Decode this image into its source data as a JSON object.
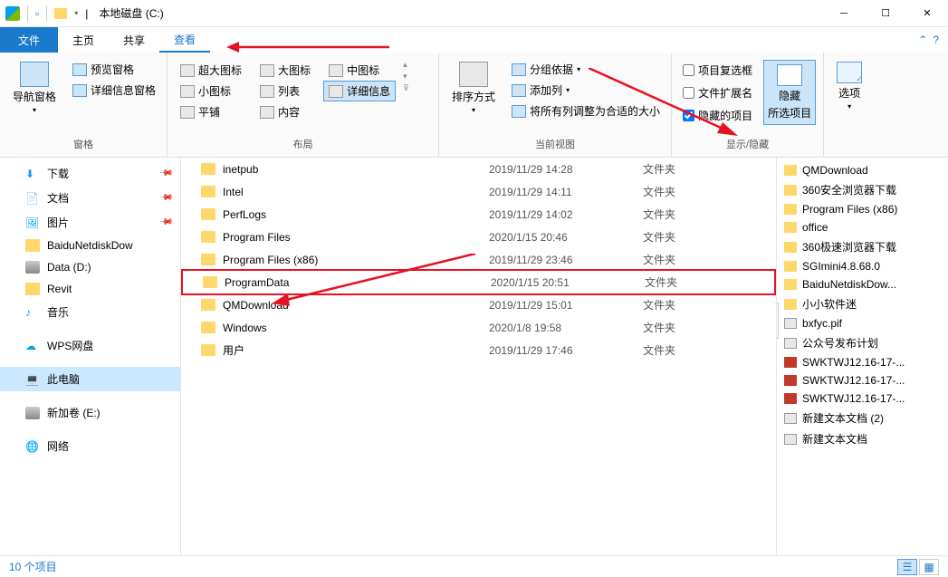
{
  "titlebar": {
    "title": "本地磁盘 (C:)",
    "divider": "|"
  },
  "menu": {
    "file": "文件",
    "home": "主页",
    "share": "共享",
    "view": "查看"
  },
  "ribbon": {
    "panes": {
      "nav_pane": "导航窗格",
      "preview_pane": "预览窗格",
      "details_pane": "详细信息窗格",
      "label": "窗格"
    },
    "layout": {
      "extra_large": "超大图标",
      "large": "大图标",
      "medium": "中图标",
      "small": "小图标",
      "list": "列表",
      "details": "详细信息",
      "tiles": "平铺",
      "content": "内容",
      "label": "布局"
    },
    "current_view": {
      "sort_by": "排序方式",
      "group_by": "分组依据",
      "add_columns": "添加列",
      "size_all": "将所有列调整为合适的大小",
      "label": "当前视图"
    },
    "show_hide": {
      "item_checkboxes": "项目复选框",
      "file_ext": "文件扩展名",
      "hidden_items": "隐藏的项目",
      "hide_selected": "隐藏",
      "hide_selected2": "所选项目",
      "label": "显示/隐藏"
    },
    "options": "选项"
  },
  "sidebar": {
    "items": [
      {
        "label": "下载",
        "icon": "down",
        "pinned": true
      },
      {
        "label": "文档",
        "icon": "doc",
        "pinned": true
      },
      {
        "label": "图片",
        "icon": "pic",
        "pinned": true
      },
      {
        "label": "BaiduNetdiskDow",
        "icon": "folder"
      },
      {
        "label": "Data (D:)",
        "icon": "drive"
      },
      {
        "label": "Revit",
        "icon": "folder"
      },
      {
        "label": "音乐",
        "icon": "music"
      },
      {
        "label": "WPS网盘",
        "icon": "wps",
        "spacer": true
      },
      {
        "label": "此电脑",
        "icon": "pc",
        "selected": true,
        "spacer": true
      },
      {
        "label": "新加卷 (E:)",
        "icon": "drive",
        "spacer": true
      },
      {
        "label": "网络",
        "icon": "net",
        "spacer": true
      }
    ]
  },
  "files": [
    {
      "name": "inetpub",
      "date": "2019/11/29 14:28",
      "type": "文件夹"
    },
    {
      "name": "Intel",
      "date": "2019/11/29 14:11",
      "type": "文件夹"
    },
    {
      "name": "PerfLogs",
      "date": "2019/11/29 14:02",
      "type": "文件夹"
    },
    {
      "name": "Program Files",
      "date": "2020/1/15 20:46",
      "type": "文件夹"
    },
    {
      "name": "Program Files (x86)",
      "date": "2019/11/29 23:46",
      "type": "文件夹"
    },
    {
      "name": "ProgramData",
      "date": "2020/1/15 20:51",
      "type": "文件夹",
      "highlight": true
    },
    {
      "name": "QMDownload",
      "date": "2019/11/29 15:01",
      "type": "文件夹"
    },
    {
      "name": "Windows",
      "date": "2020/1/8 19:58",
      "type": "文件夹"
    },
    {
      "name": "用户",
      "date": "2019/11/29 17:46",
      "type": "文件夹"
    }
  ],
  "preview": [
    {
      "label": "QMDownload",
      "icon": "folder"
    },
    {
      "label": "360安全浏览器下载",
      "icon": "folder"
    },
    {
      "label": "Program Files (x86)",
      "icon": "folder"
    },
    {
      "label": "office",
      "icon": "folder"
    },
    {
      "label": "360极速浏览器下载",
      "icon": "folder"
    },
    {
      "label": "SGImini4.8.68.0",
      "icon": "folder"
    },
    {
      "label": "BaiduNetdiskDow...",
      "icon": "folder"
    },
    {
      "label": "小小软件迷",
      "icon": "folder"
    },
    {
      "label": "bxfyc.pif",
      "icon": "file"
    },
    {
      "label": "公众号发布计划",
      "icon": "file"
    },
    {
      "label": "SWKTWJ12.16-17-...",
      "icon": "rar"
    },
    {
      "label": "SWKTWJ12.16-17-...",
      "icon": "rar"
    },
    {
      "label": "SWKTWJ12.16-17-...",
      "icon": "rar"
    },
    {
      "label": "新建文本文档 (2)",
      "icon": "file"
    },
    {
      "label": "新建文本文档",
      "icon": "file"
    }
  ],
  "statusbar": {
    "count": "10 个项目"
  }
}
